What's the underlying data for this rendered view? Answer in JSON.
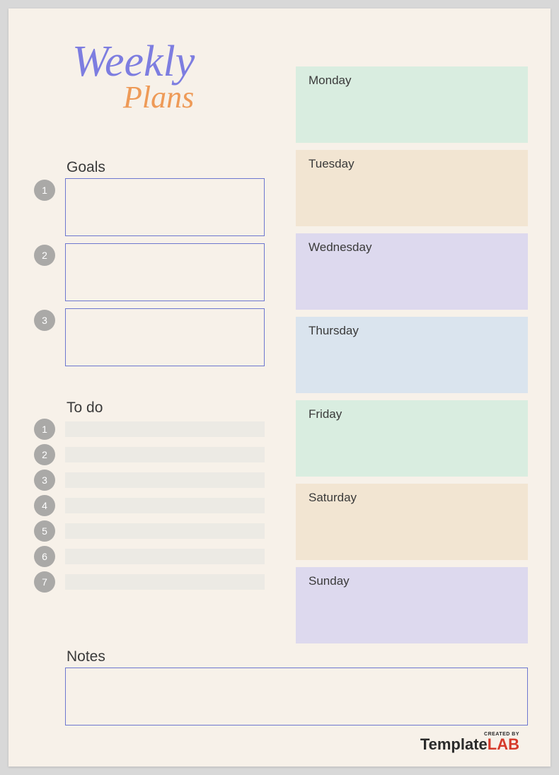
{
  "title": {
    "line1": "Weekly",
    "line2": "Plans"
  },
  "sections": {
    "goals": "Goals",
    "todo": "To do",
    "notes": "Notes"
  },
  "goals": [
    {
      "num": "1"
    },
    {
      "num": "2"
    },
    {
      "num": "3"
    }
  ],
  "todos": [
    {
      "num": "1"
    },
    {
      "num": "2"
    },
    {
      "num": "3"
    },
    {
      "num": "4"
    },
    {
      "num": "5"
    },
    {
      "num": "6"
    },
    {
      "num": "7"
    }
  ],
  "days": [
    {
      "label": "Monday"
    },
    {
      "label": "Tuesday"
    },
    {
      "label": "Wednesday"
    },
    {
      "label": "Thursday"
    },
    {
      "label": "Friday"
    },
    {
      "label": "Saturday"
    },
    {
      "label": "Sunday"
    }
  ],
  "footer": {
    "created_by": "CREATED BY",
    "brand_a": "Template",
    "brand_b": "LAB"
  }
}
